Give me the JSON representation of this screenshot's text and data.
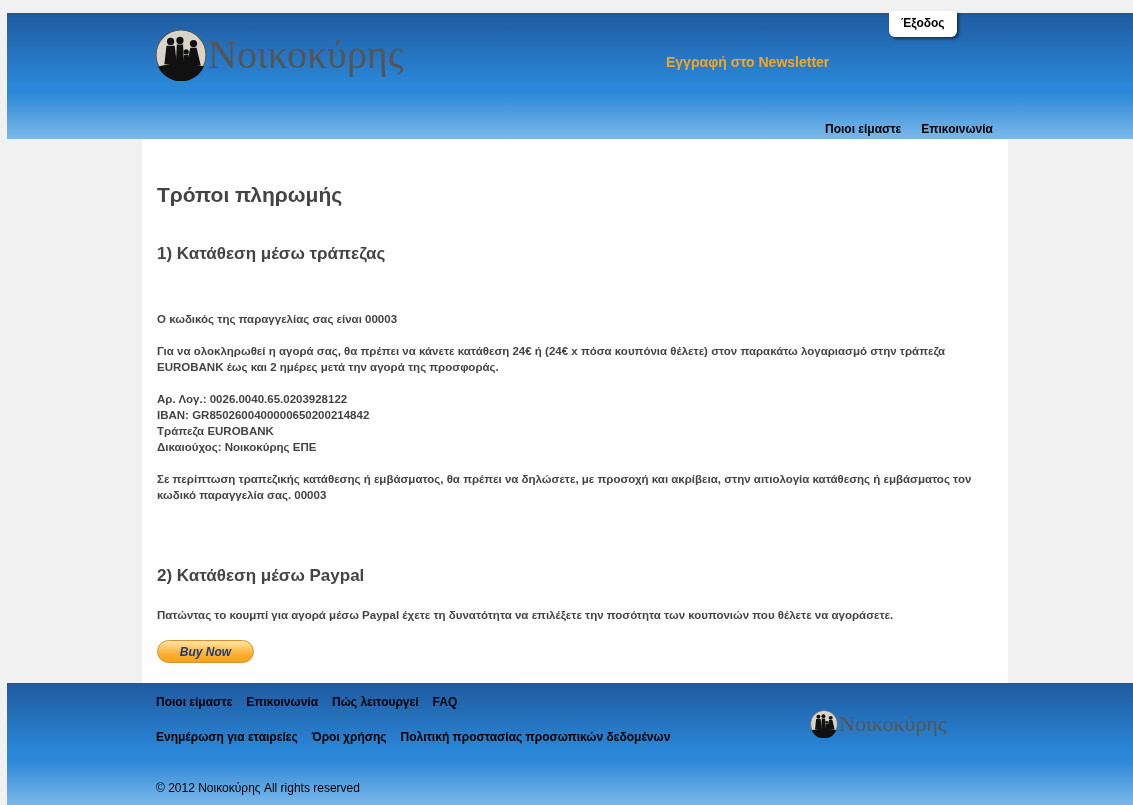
{
  "header": {
    "logo_text": "Νοικοκύρης",
    "logout": "Έξοδος",
    "newsletter": "Εγγραφή στο Newsletter",
    "nav": [
      "Ποιοι είμαστε",
      "Επικοινωνία"
    ]
  },
  "page_title": "Τρόποι πληρωμής",
  "sections": [
    {
      "heading": "1) Κατάθεση μέσω τράπεζας",
      "paragraphs": [
        [
          "Ο κωδικός της παραγγελίας σας είναι 00003"
        ],
        [
          "Για να ολοκληρωθεί η αγορά σας, θα πρέπει να κάνετε κατάθεση 24€ ή (24€ x πόσα κουπόνια θέλετε) στον παρακάτω λογαριασμό στην τράπεζα EUROBANK έως και 2 ημέρες μετά την αγορά της προσφοράς."
        ],
        [
          "Αρ. Λογ.: 0026.0040.65.0203928122",
          "IBAN: GR8502600400000650200214842",
          "Τράπεζα EUROBANK",
          "Δικαιούχος: Νοικοκύρης ΕΠΕ"
        ],
        [
          "Σε περίπτωση τραπεζικής κατάθεσης ή εμβάσματος, θα πρέπει να δηλώσετε, με προσοχή και ακρίβεια, στην αιτιολογία κατάθεσης ή εμβάσματος τον κωδικό παραγγελία σας. 00003"
        ]
      ]
    },
    {
      "heading": "2) Κατάθεση μέσω Paypal",
      "paragraphs": [
        [
          "Πατώντας το κουμπί για αγορά μέσω Paypal έχετε τη δυνατότητα να επιλέξετε την ποσότητα των κουπονιών που θέλετε να αγοράσετε."
        ]
      ],
      "button": "Buy Now"
    }
  ],
  "footer": {
    "links_row_1": [
      "Ποιοι είμαστε",
      "Επικοινωνία",
      "Πώς λειτουργεί",
      "FAQ"
    ],
    "links_row_2": [
      "Ενημέρωση για εταιρείες",
      "Όροι χρήσης",
      "Πολιτική προστασίας προσωπικών δεδομένων"
    ],
    "logo_text": "Νοικοκύρης",
    "copyright": "© 2012 Νοικοκύρης All rights reserved"
  }
}
